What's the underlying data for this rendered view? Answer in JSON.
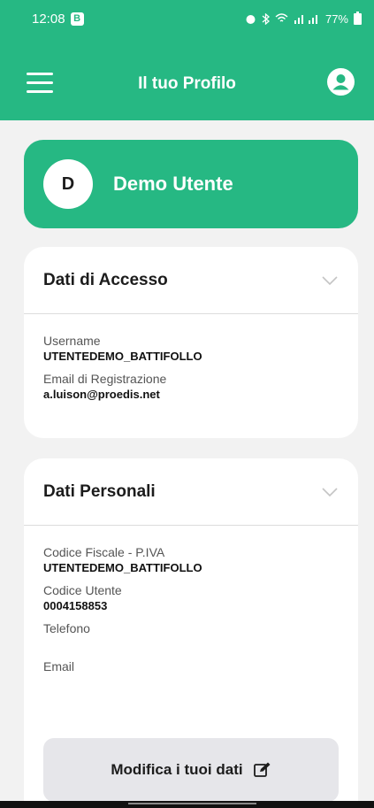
{
  "status_bar": {
    "time": "12:08",
    "badge": "B",
    "battery": "77%"
  },
  "app_bar": {
    "title": "Il tuo Profilo",
    "menu_icon": "hamburger-menu-icon",
    "profile_icon": "user-account-icon"
  },
  "user": {
    "initial": "D",
    "name": "Demo Utente"
  },
  "access_section": {
    "title": "Dati di Accesso",
    "fields": [
      {
        "label": "Username",
        "value": "UTENTEDEMO_BATTIFOLLO"
      },
      {
        "label": "Email di Registrazione",
        "value": "a.luison@proedis.net"
      }
    ]
  },
  "personal_section": {
    "title": "Dati Personali",
    "fields": [
      {
        "label": "Codice Fiscale - P.IVA",
        "value": "UTENTEDEMO_BATTIFOLLO"
      },
      {
        "label": "Codice Utente",
        "value": "0004158853"
      },
      {
        "label": "Telefono",
        "value": ""
      },
      {
        "label": "Email",
        "value": ""
      }
    ],
    "edit_button": "Modifica i tuoi dati",
    "edit_icon": "edit-pencil-icon"
  },
  "colors": {
    "brand": "#26b883",
    "card": "#ffffff",
    "background": "#f2f2f2",
    "button": "#e6e6ea"
  }
}
